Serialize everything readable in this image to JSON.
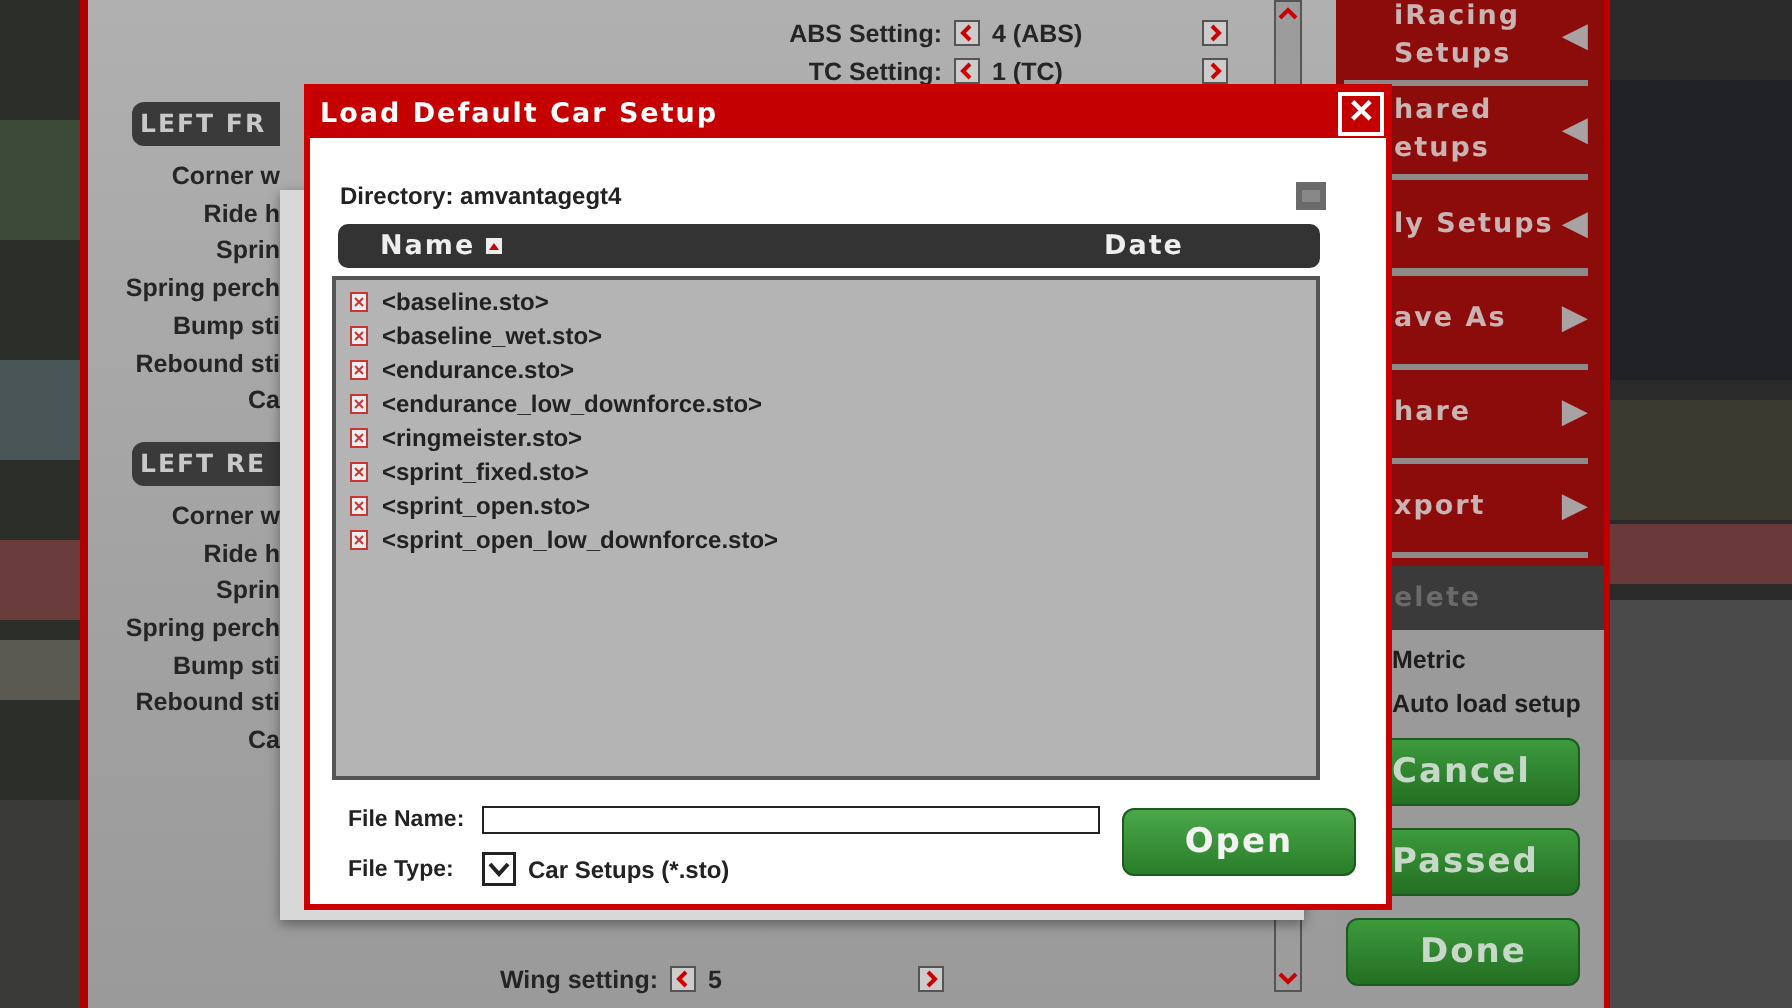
{
  "setup_panel": {
    "top_settings": [
      {
        "label": "ABS Setting:",
        "value": "4 (ABS)"
      },
      {
        "label": "TC Setting:",
        "value": "1 (TC)"
      }
    ],
    "sections": [
      {
        "heading": "LEFT FR",
        "labels": [
          "Corner w",
          "Ride h",
          "Sprin",
          "Spring perch",
          "Bump sti",
          "Rebound sti",
          "Ca"
        ]
      },
      {
        "heading": "LEFT RE",
        "labels": [
          "Corner w",
          "Ride h",
          "Sprin",
          "Spring perch",
          "Bump sti",
          "Rebound sti",
          "Ca"
        ]
      }
    ],
    "bottom_settings": [
      {
        "label": "Wing setting:",
        "value": "5"
      }
    ]
  },
  "sidebar": {
    "items": [
      {
        "lines": [
          "iRacing",
          "Setups"
        ],
        "arrow": "◀",
        "disabled": false
      },
      {
        "lines": [
          "hared",
          "etups"
        ],
        "arrow": "◀",
        "disabled": false
      },
      {
        "lines": [
          "ly Setups"
        ],
        "arrow": "◀",
        "disabled": false
      },
      {
        "lines": [
          "ave As"
        ],
        "arrow": "▶",
        "disabled": false
      },
      {
        "lines": [
          "hare"
        ],
        "arrow": "▶",
        "disabled": false
      },
      {
        "lines": [
          "xport"
        ],
        "arrow": "▶",
        "disabled": false
      },
      {
        "lines": [
          "elete"
        ],
        "disabled": true
      }
    ],
    "options": [
      "Metric",
      "Auto load setup"
    ],
    "buttons": [
      "Cancel",
      "Passed",
      "Done"
    ]
  },
  "dialog": {
    "title": "Load Default Car Setup",
    "close": "✕",
    "directory_label": "Directory:",
    "directory": "amvantagegt4",
    "columns": [
      {
        "label": "Name",
        "sorted": true
      },
      {
        "label": "Date",
        "sorted": false
      }
    ],
    "files": [
      "<baseline.sto>",
      "<baseline_wet.sto>",
      "<endurance.sto>",
      "<endurance_low_downforce.sto>",
      "<ringmeister.sto>",
      "<sprint_fixed.sto>",
      "<sprint_open.sto>",
      "<sprint_open_low_downforce.sto>"
    ],
    "file_name_label": "File Name:",
    "file_type_label": "File Type:",
    "file_type": "Car Setups (*.sto)",
    "open_button": "Open"
  }
}
